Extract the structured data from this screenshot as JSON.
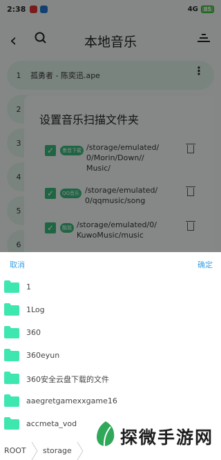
{
  "status": {
    "time": "2:38",
    "network": "4G",
    "battery": "85"
  },
  "topbar": {
    "title": "本地音乐"
  },
  "songs": [
    {
      "num": "1",
      "name": "孤勇者 - 陈奕迅.ape"
    },
    {
      "num": "2",
      "name": ""
    },
    {
      "num": "3",
      "name": ""
    },
    {
      "num": "4",
      "name": ""
    },
    {
      "num": "5",
      "name": ""
    },
    {
      "num": "6",
      "name": ""
    }
  ],
  "dialog": {
    "title": "设置音乐扫描文件夹",
    "items": [
      {
        "tag": "墨音下载",
        "path_line1": "/storage/emulated/",
        "path_line2": "0/Morin/Down//",
        "path_line3": "Music/"
      },
      {
        "tag": "QQ音乐",
        "path_line1": "/storage/emulated/",
        "path_line2": "0/qqmusic/song",
        "path_line3": ""
      },
      {
        "tag": "酷我",
        "path_line1": "/storage/emulated/0/",
        "path_line2": "KuwoMusic/music",
        "path_line3": ""
      }
    ]
  },
  "sheet": {
    "cancel": "取消",
    "ok": "确定",
    "folders": [
      "1",
      "1Log",
      "360",
      "360eyun",
      "360安全云盘下载的文件",
      "aaegretgamexxgame16",
      "accmeta_vod"
    ]
  },
  "pathbar": {
    "root": "ROOT",
    "current": "storage"
  },
  "watermark": {
    "text": "探微手游网"
  },
  "colors": {
    "accent": "#37b87a",
    "folder": "#3ee6b0",
    "link": "#3aa0e8"
  }
}
